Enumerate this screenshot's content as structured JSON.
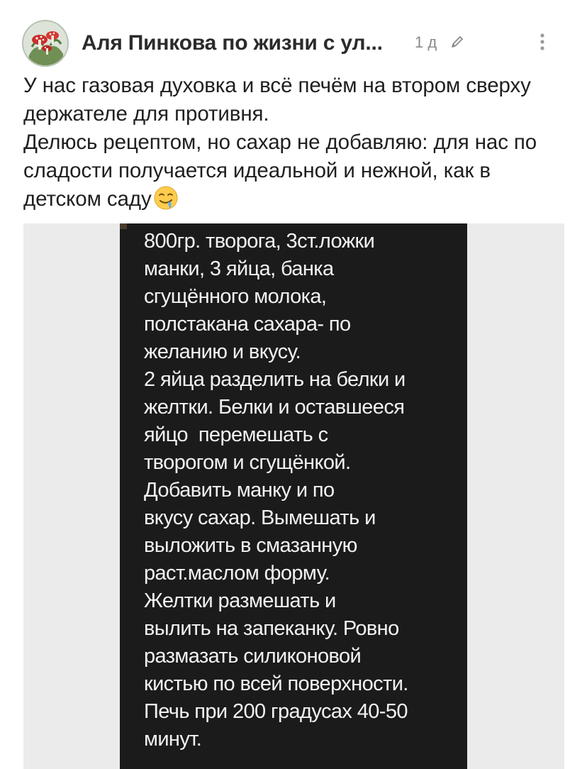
{
  "post": {
    "author": "Аля Пинкова по жизни с ул...",
    "time": "1 д",
    "icons": {
      "avatar": "avatar-mushroom-embroidery",
      "edit": "pencil-icon",
      "more": "more-vertical-icon",
      "emoji": "drooling-face-emoji"
    },
    "text_line1": "У нас газовая духовка и всё печём на втором сверху держателе для противня.",
    "text_line2": "Делюсь рецептом, но сахар не добавляю: для нас по сладости получается идеальной и нежной, как в детском саду"
  },
  "image": {
    "recipe_lines": [
      "800гр. творога, 3ст.ложки",
      "манки, 3 яйца, банка",
      "сгущённого молока,",
      "полстакана сахара- по",
      "желанию и вкусу.",
      "2 яйца разделить на белки и",
      "желтки. Белки и оставшееся",
      "яйцо  перемешать с",
      "творогом и сгущёнкой.",
      "Добавить манку и по",
      "вкусу сахар. Вымешать и",
      "выложить в смазанную",
      "раст.маслом форму.",
      "Желтки размешать и",
      "вылить на запеканку. Ровно",
      "размазать силиконовой",
      "кистью по всей поверхности.",
      "Печь при 200 градусах 40-50",
      "минут."
    ]
  },
  "colors": {
    "text": "#1f1f1f",
    "secondary": "#8a8a8a",
    "image_dark": "#1b1b1b",
    "image_light": "#ebebeb",
    "recipe_text": "#f2f2f2"
  }
}
